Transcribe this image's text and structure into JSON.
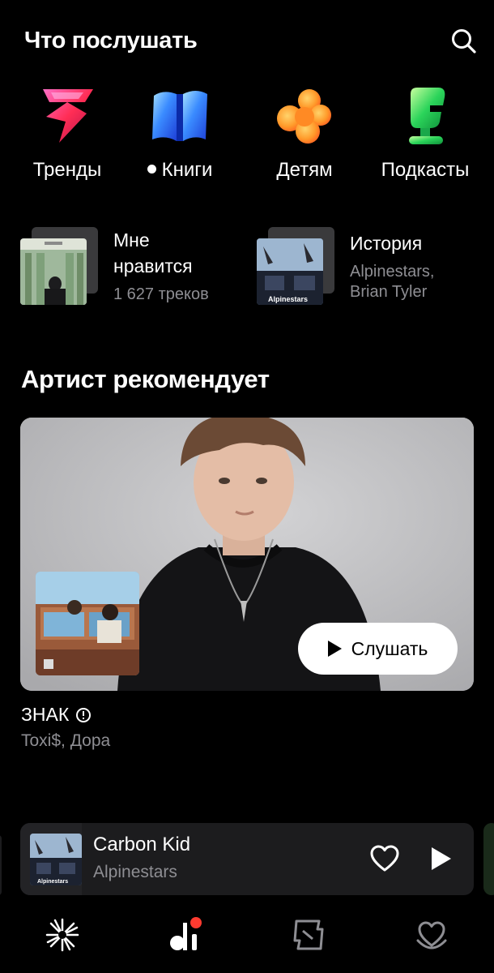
{
  "header": {
    "title": "Что послушать"
  },
  "categories": [
    {
      "label": "Тренды",
      "icon": "trends-icon",
      "has_dot": false
    },
    {
      "label": "Книги",
      "icon": "books-icon",
      "has_dot": true
    },
    {
      "label": "Детям",
      "icon": "kids-icon",
      "has_dot": false
    },
    {
      "label": "Подкасты",
      "icon": "podcasts-icon",
      "has_dot": false
    }
  ],
  "tiles": {
    "liked": {
      "title_line1": "Мне",
      "title_line2": "нравится",
      "subtitle": "1 627 треков"
    },
    "history": {
      "title": "История",
      "subtitle_line1": "Alpinestars,",
      "subtitle_line2": "Brian Tyler"
    }
  },
  "section": {
    "title": "Артист рекомендует"
  },
  "recommendation": {
    "listen_label": "Слушать",
    "album_title": "ЗНАК",
    "album_artists": "Toxi$, Дора"
  },
  "mini_player": {
    "track": "Carbon Kid",
    "artist": "Alpinestars"
  },
  "colors": {
    "background": "#000000",
    "secondary_text": "#8e8e93",
    "card": "#1c1c1e",
    "accent_dot": "#ff3b30"
  }
}
